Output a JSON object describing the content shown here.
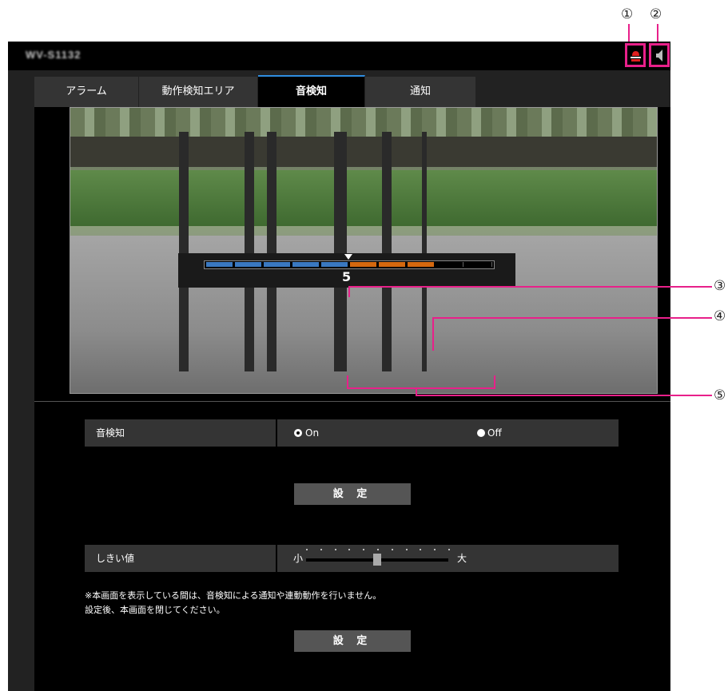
{
  "callouts": [
    "①",
    "②",
    "③",
    "④",
    "⑤"
  ],
  "header": {
    "model_name": "WV-S1132",
    "alarm_icon": "alarm-light-icon",
    "audio_icon": "speaker-icon"
  },
  "tabs": [
    {
      "label": "アラーム",
      "active": false
    },
    {
      "label": "動作検知エリア",
      "active": false
    },
    {
      "label": "音検知",
      "active": true
    },
    {
      "label": "通知",
      "active": false
    }
  ],
  "level_meter": {
    "segments": [
      "blue",
      "blue",
      "blue",
      "blue",
      "blue",
      "orange",
      "orange",
      "orange",
      "empty",
      "empty"
    ],
    "threshold_value": "5"
  },
  "settings": {
    "sound_detection": {
      "label": "音検知",
      "on_label": "On",
      "off_label": "Off",
      "selected": "On"
    },
    "set_button_1": "設 定",
    "threshold": {
      "label": "しきい値",
      "min_label": "小",
      "max_label": "大",
      "value": 5,
      "steps": 10
    },
    "note_line1": "※本画面を表示している間は、音検知による通知や連動動作を行いません。",
    "note_line2": "設定後、本画面を閉じてください。",
    "set_button_2": "設 定"
  },
  "colors": {
    "accent_pink": "#e8208a",
    "tab_active_border": "#2f8de0",
    "meter_blue": "#3a78c0",
    "meter_orange": "#d4680f"
  }
}
